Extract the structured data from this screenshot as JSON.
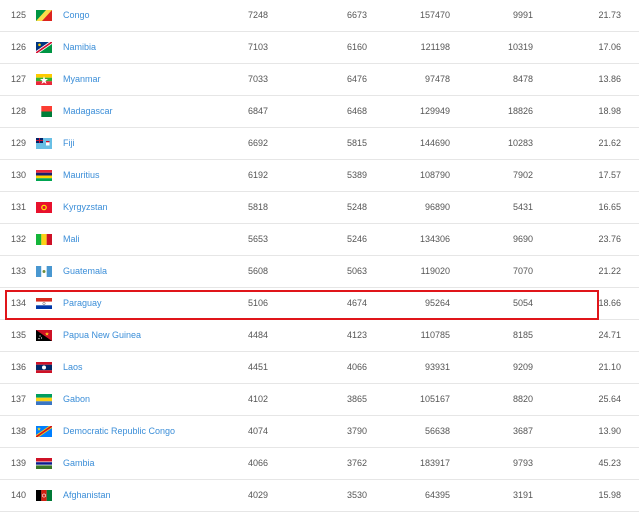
{
  "rows": [
    {
      "rank": "125",
      "country": "Congo",
      "flag": "congo-flag",
      "v1": "7248",
      "v2": "6673",
      "v3": "157470",
      "v4": "9991",
      "v5": "21.73"
    },
    {
      "rank": "126",
      "country": "Namibia",
      "flag": "namibia-flag",
      "v1": "7103",
      "v2": "6160",
      "v3": "121198",
      "v4": "10319",
      "v5": "17.06"
    },
    {
      "rank": "127",
      "country": "Myanmar",
      "flag": "myanmar-flag",
      "v1": "7033",
      "v2": "6476",
      "v3": "97478",
      "v4": "8478",
      "v5": "13.86"
    },
    {
      "rank": "128",
      "country": "Madagascar",
      "flag": "madagascar-flag",
      "v1": "6847",
      "v2": "6468",
      "v3": "129949",
      "v4": "18826",
      "v5": "18.98"
    },
    {
      "rank": "129",
      "country": "Fiji",
      "flag": "fiji-flag",
      "v1": "6692",
      "v2": "5815",
      "v3": "144690",
      "v4": "10283",
      "v5": "21.62"
    },
    {
      "rank": "130",
      "country": "Mauritius",
      "flag": "mauritius-flag",
      "v1": "6192",
      "v2": "5389",
      "v3": "108790",
      "v4": "7902",
      "v5": "17.57"
    },
    {
      "rank": "131",
      "country": "Kyrgyzstan",
      "flag": "kyrgyzstan-flag",
      "v1": "5818",
      "v2": "5248",
      "v3": "96890",
      "v4": "5431",
      "v5": "16.65"
    },
    {
      "rank": "132",
      "country": "Mali",
      "flag": "mali-flag",
      "v1": "5653",
      "v2": "5246",
      "v3": "134306",
      "v4": "9690",
      "v5": "23.76"
    },
    {
      "rank": "133",
      "country": "Guatemala",
      "flag": "guatemala-flag",
      "v1": "5608",
      "v2": "5063",
      "v3": "119020",
      "v4": "7070",
      "v5": "21.22"
    },
    {
      "rank": "134",
      "country": "Paraguay",
      "flag": "paraguay-flag",
      "v1": "5106",
      "v2": "4674",
      "v3": "95264",
      "v4": "5054",
      "v5": "18.66"
    },
    {
      "rank": "135",
      "country": "Papua New Guinea",
      "flag": "papua-new-guinea-flag",
      "v1": "4484",
      "v2": "4123",
      "v3": "110785",
      "v4": "8185",
      "v5": "24.71"
    },
    {
      "rank": "136",
      "country": "Laos",
      "flag": "laos-flag",
      "v1": "4451",
      "v2": "4066",
      "v3": "93931",
      "v4": "9209",
      "v5": "21.10"
    },
    {
      "rank": "137",
      "country": "Gabon",
      "flag": "gabon-flag",
      "v1": "4102",
      "v2": "3865",
      "v3": "105167",
      "v4": "8820",
      "v5": "25.64"
    },
    {
      "rank": "138",
      "country": "Democratic Republic Congo",
      "flag": "dr-congo-flag",
      "v1": "4074",
      "v2": "3790",
      "v3": "56638",
      "v4": "3687",
      "v5": "13.90"
    },
    {
      "rank": "139",
      "country": "Gambia",
      "flag": "gambia-flag",
      "v1": "4066",
      "v2": "3762",
      "v3": "183917",
      "v4": "9793",
      "v5": "45.23"
    },
    {
      "rank": "140",
      "country": "Afghanistan",
      "flag": "afghanistan-flag",
      "v1": "4029",
      "v2": "3530",
      "v3": "64395",
      "v4": "3191",
      "v5": "15.98"
    }
  ],
  "highlighted_rank": "134",
  "colors": {
    "link": "#3b8ed8",
    "highlight_border": "#e0151a",
    "row_border": "#e6e6e6",
    "text": "#555555"
  }
}
